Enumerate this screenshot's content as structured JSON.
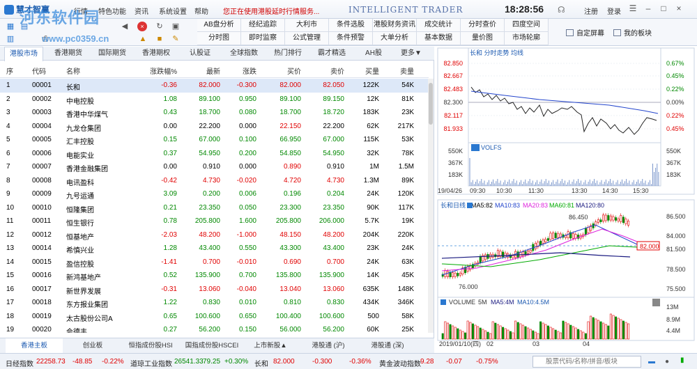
{
  "app": {
    "brand": "慧才智赢",
    "title": "INTELLIGENT TRADER",
    "clock": "18:28:56",
    "notice": "您正在使用港股延时行情服务..."
  },
  "menu": [
    "行情",
    "特色功能",
    "资讯",
    "系统设置",
    "帮助"
  ],
  "account": {
    "register": "注册",
    "login": "登录"
  },
  "function_grid": [
    [
      "AB盘分析",
      "经纪追踪",
      "大利市",
      "条件选股",
      "港股财务资讯",
      "成交统计",
      "分时查价",
      "四度空间"
    ],
    [
      "分时图",
      "即时监察",
      "公式管理",
      "条件预警",
      "大单分析",
      "基本数据",
      "量价图",
      "市场轮廓"
    ]
  ],
  "right_buttons": {
    "custom_screen": "自定屏幕",
    "my_sector": "我的板块"
  },
  "market_tabs": [
    "港股市场",
    "香港期货",
    "国际期货",
    "香港期权",
    "认股证",
    "全球指数",
    "热门排行",
    "霸才精选",
    "AH股",
    "更多▼"
  ],
  "columns": [
    "序",
    "代码",
    "名称",
    "涨跌幅%",
    "最新",
    "涨跌",
    "买价",
    "卖价",
    "买量",
    "卖量"
  ],
  "rows": [
    {
      "n": "1",
      "code": "00001",
      "name": "长和",
      "pct": "-0.36",
      "last": "82.000",
      "chg": "-0.300",
      "bid": "82.000",
      "ask": "82.050",
      "bv": "122K",
      "av": "54K",
      "dir": "dn"
    },
    {
      "n": "2",
      "code": "00002",
      "name": "中电控股",
      "pct": "1.08",
      "last": "89.100",
      "chg": "0.950",
      "bid": "89.100",
      "ask": "89.150",
      "bv": "12K",
      "av": "81K",
      "dir": "up"
    },
    {
      "n": "3",
      "code": "00003",
      "name": "香港中华煤气",
      "pct": "0.43",
      "last": "18.700",
      "chg": "0.080",
      "bid": "18.700",
      "ask": "18.720",
      "bv": "183K",
      "av": "23K",
      "dir": "up"
    },
    {
      "n": "4",
      "code": "00004",
      "name": "九龙仓集团",
      "pct": "0.00",
      "last": "22.200",
      "chg": "0.000",
      "bid": "22.150",
      "ask": "22.200",
      "bv": "62K",
      "av": "217K",
      "dir": "eq"
    },
    {
      "n": "5",
      "code": "00005",
      "name": "汇丰控股",
      "pct": "0.15",
      "last": "67.000",
      "chg": "0.100",
      "bid": "66.950",
      "ask": "67.000",
      "bv": "115K",
      "av": "53K",
      "dir": "up"
    },
    {
      "n": "6",
      "code": "00006",
      "name": "电能实业",
      "pct": "0.37",
      "last": "54.950",
      "chg": "0.200",
      "bid": "54.850",
      "ask": "54.950",
      "bv": "32K",
      "av": "78K",
      "dir": "up"
    },
    {
      "n": "7",
      "code": "00007",
      "name": "香港金融集团",
      "pct": "0.00",
      "last": "0.910",
      "chg": "0.000",
      "bid": "0.890",
      "ask": "0.910",
      "bv": "1M",
      "av": "1.5M",
      "dir": "eq"
    },
    {
      "n": "8",
      "code": "00008",
      "name": "电讯盈科",
      "pct": "-0.42",
      "last": "4.730",
      "chg": "-0.020",
      "bid": "4.720",
      "ask": "4.730",
      "bv": "1.3M",
      "av": "89K",
      "dir": "dn"
    },
    {
      "n": "9",
      "code": "00009",
      "name": "九号运通",
      "pct": "3.09",
      "last": "0.200",
      "chg": "0.006",
      "bid": "0.196",
      "ask": "0.204",
      "bv": "24K",
      "av": "120K",
      "dir": "up"
    },
    {
      "n": "10",
      "code": "00010",
      "name": "恒隆集团",
      "pct": "0.21",
      "last": "23.350",
      "chg": "0.050",
      "bid": "23.300",
      "ask": "23.350",
      "bv": "90K",
      "av": "117K",
      "dir": "up"
    },
    {
      "n": "11",
      "code": "00011",
      "name": "恒生银行",
      "pct": "0.78",
      "last": "205.800",
      "chg": "1.600",
      "bid": "205.800",
      "ask": "206.000",
      "bv": "5.7K",
      "av": "19K",
      "dir": "up"
    },
    {
      "n": "12",
      "code": "00012",
      "name": "恒基地产",
      "pct": "-2.03",
      "last": "48.200",
      "chg": "-1.000",
      "bid": "48.150",
      "ask": "48.200",
      "bv": "204K",
      "av": "220K",
      "dir": "dn"
    },
    {
      "n": "13",
      "code": "00014",
      "name": "希慎兴业",
      "pct": "1.28",
      "last": "43.400",
      "chg": "0.550",
      "bid": "43.300",
      "ask": "43.400",
      "bv": "23K",
      "av": "24K",
      "dir": "up"
    },
    {
      "n": "14",
      "code": "00015",
      "name": "盈信控股",
      "pct": "-1.41",
      "last": "0.700",
      "chg": "-0.010",
      "bid": "0.690",
      "ask": "0.700",
      "bv": "24K",
      "av": "63K",
      "dir": "dn"
    },
    {
      "n": "15",
      "code": "00016",
      "name": "新鸿基地产",
      "pct": "0.52",
      "last": "135.900",
      "chg": "0.700",
      "bid": "135.800",
      "ask": "135.900",
      "bv": "14K",
      "av": "45K",
      "dir": "up"
    },
    {
      "n": "16",
      "code": "00017",
      "name": "新世界发展",
      "pct": "-0.31",
      "last": "13.060",
      "chg": "-0.040",
      "bid": "13.040",
      "ask": "13.060",
      "bv": "635K",
      "av": "148K",
      "dir": "dn"
    },
    {
      "n": "17",
      "code": "00018",
      "name": "东方报业集团",
      "pct": "1.22",
      "last": "0.830",
      "chg": "0.010",
      "bid": "0.810",
      "ask": "0.830",
      "bv": "434K",
      "av": "346K",
      "dir": "up"
    },
    {
      "n": "18",
      "code": "00019",
      "name": "太古股份公司A",
      "pct": "0.65",
      "last": "100.600",
      "chg": "0.650",
      "bid": "100.400",
      "ask": "100.600",
      "bv": "500",
      "av": "58K",
      "dir": "up"
    },
    {
      "n": "19",
      "code": "00020",
      "name": "会德丰",
      "pct": "0.27",
      "last": "56.200",
      "chg": "0.150",
      "bid": "56.000",
      "ask": "56.200",
      "bv": "60K",
      "av": "25K",
      "dir": "up"
    }
  ],
  "bottom_tabs": [
    "香港主板",
    "创业板",
    "恒指成份股HSI",
    "国指成份股HSCEI",
    "上市新股▲",
    "港股通 (沪)",
    "港股通 (深)"
  ],
  "intraday": {
    "title": "长和  分时走势  均线",
    "price_ticks": [
      "82.850",
      "82.667",
      "82.483",
      "82.300",
      "82.117",
      "81.933"
    ],
    "pct_ticks": [
      "0.67%",
      "0.45%",
      "0.22%",
      "0.00%",
      "0.22%",
      "0.45%"
    ],
    "volume_label": "VOLFS",
    "vol_ticks": [
      "550K",
      "367K",
      "183K"
    ],
    "time_labels": [
      "19/04/26",
      "09:30",
      "10:30",
      "11:30",
      "13:30",
      "14:30",
      "15:30"
    ]
  },
  "kline": {
    "title": "长和日线",
    "ma": [
      {
        "label": "MA5:82",
        "color": "#000000"
      },
      {
        "label": "MA10:83",
        "color": "#2244cc"
      },
      {
        "label": "MA20:83",
        "color": "#dd22dd"
      },
      {
        "label": "MA60:81",
        "color": "#00aa00"
      },
      {
        "label": "MA120:80",
        "color": "#1a1a80"
      }
    ],
    "price_ticks": [
      "86.500",
      "84.000",
      "81.500",
      "78.500",
      "75.500"
    ],
    "high_label": "86.450",
    "low_label": "76.000",
    "last_price": "82.000",
    "volume_title": "VOLUME",
    "volume_ma": [
      "5M",
      "MA5:4M",
      "MA10:4.5M"
    ],
    "vol_ticks": [
      "13M",
      "8.9M",
      "4.4M"
    ],
    "date_labels": [
      "2019/01/10(四)",
      "02",
      "03",
      "04"
    ]
  },
  "status": {
    "items": [
      {
        "name": "日经指数",
        "value": "22258.73",
        "chg": "-48.85",
        "pct": "-0.22%",
        "dir": "dn"
      },
      {
        "name": "道琼工业指数",
        "value": "26541.33",
        "chg": "79.25",
        "pct": "+0.30%",
        "dir": "up"
      },
      {
        "name": "长和",
        "value": "82.000",
        "chg": "-0.300",
        "pct": "-0.36%",
        "dir": "dn"
      },
      {
        "name": "黄金波动指数",
        "value": "9.28",
        "chg": "-0.07",
        "pct": "-0.75%",
        "dir": "dn"
      }
    ],
    "search_placeholder": "股票代码/名称/拼音/板块"
  },
  "watermark": {
    "line1": "河东软件园",
    "line2": "www.pc0359.cn"
  },
  "colors": {
    "up": "#e00000",
    "down": "#008800",
    "accent": "#1a58b0"
  }
}
